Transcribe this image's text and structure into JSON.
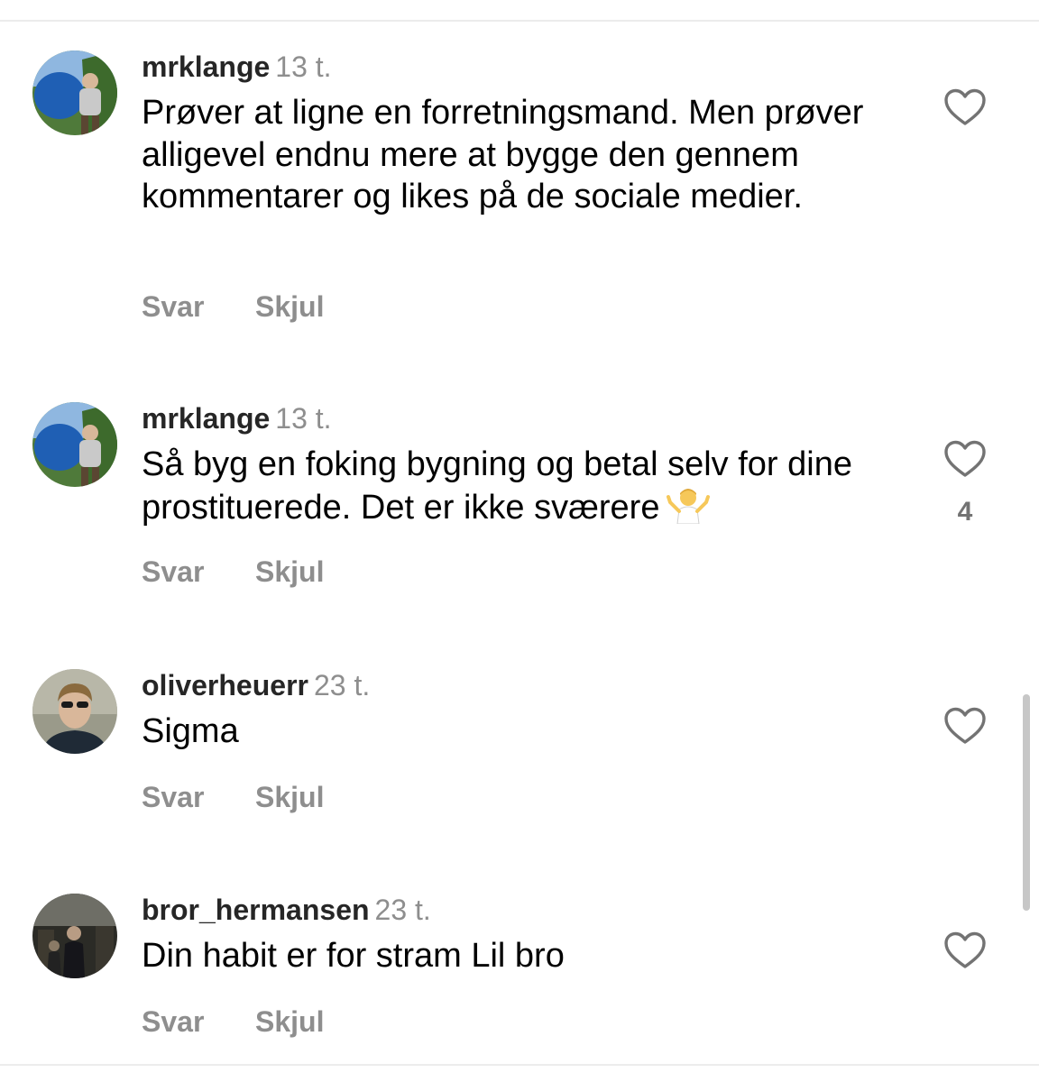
{
  "comments": [
    {
      "username": "mrklange",
      "time": "13 t.",
      "text": "Prøver at ligne en forretningsmand. Men prøver alligevel endnu mere at bygge den gennem kommentarer og likes på de sociale medier.",
      "reply_label": "Svar",
      "hide_label": "Skjul",
      "likes": ""
    },
    {
      "username": "mrklange",
      "time": "13 t.",
      "text": "Så byg en foking bygning og betal selv for dine prostituerede. Det er ikke sværere",
      "emoji": "person-shrugging",
      "reply_label": "Svar",
      "hide_label": "Skjul",
      "likes": "4"
    },
    {
      "username": "oliverheuerr",
      "time": "23 t.",
      "text": "Sigma",
      "reply_label": "Svar",
      "hide_label": "Skjul",
      "likes": ""
    },
    {
      "username": "bror_hermansen",
      "time": "23 t.",
      "text": "Din habit er for stram Lil bro",
      "reply_label": "Svar",
      "hide_label": "Skjul",
      "likes": ""
    }
  ],
  "icons": {
    "like": "heart-outline-icon",
    "emoji": "person-shrugging-emoji"
  },
  "colors": {
    "username": "#262626",
    "meta": "#8e8e8e",
    "text": "#000000",
    "heart": "#737373"
  }
}
